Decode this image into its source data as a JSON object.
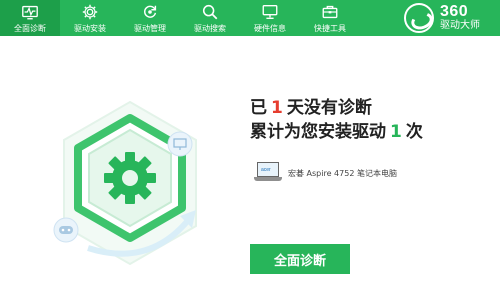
{
  "toolbar": {
    "tabs": [
      {
        "label": "全面诊断",
        "icon": "pulse-icon",
        "active": true
      },
      {
        "label": "驱动安装",
        "icon": "gear-icon",
        "active": false
      },
      {
        "label": "驱动管理",
        "icon": "refresh-icon",
        "active": false
      },
      {
        "label": "驱动搜索",
        "icon": "search-icon",
        "active": false
      },
      {
        "label": "硬件信息",
        "icon": "monitor-icon",
        "active": false
      },
      {
        "label": "快捷工具",
        "icon": "toolbox-icon",
        "active": false
      }
    ],
    "brand": {
      "number": "360",
      "name": "驱动大师"
    }
  },
  "status": {
    "line1_prefix": "已",
    "days": "1",
    "line1_suffix": "天没有诊断",
    "line2_prefix": "累计为您安装驱动",
    "install_count": "1",
    "line2_suffix": "次"
  },
  "device": {
    "screen_brand": "acer",
    "name": "宏碁 Aspire 4752 笔记本电脑"
  },
  "actions": {
    "scan_label": "全面诊断"
  },
  "colors": {
    "accent": "#27b55a",
    "accent_dark": "#1d9f4a",
    "highlight_red": "#e63d2f"
  }
}
